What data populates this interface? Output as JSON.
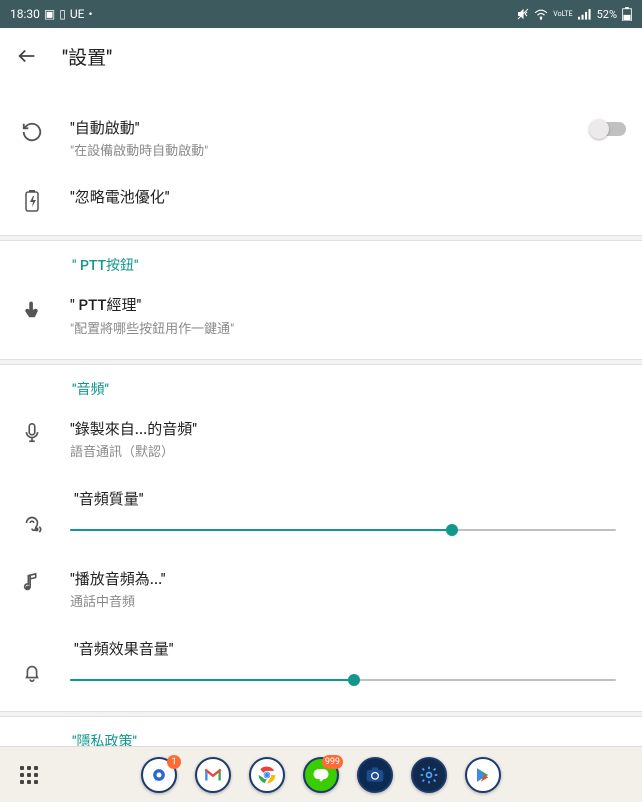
{
  "status": {
    "time": "18:30",
    "carrier": "UE",
    "battery_pct": "52%"
  },
  "header": {
    "title": "\"設置\""
  },
  "sections": {
    "autostart": {
      "title": "\"自動啟動\"",
      "subtitle": "\"在設備啟動時自動啟動\"",
      "switch": false
    },
    "battery": {
      "title": "\"忽略電池優化\""
    },
    "ptt_header": "\" PTT按鈕\"",
    "ptt_manager": {
      "title": "\" PTT經理\"",
      "subtitle": "\"配置將哪些按鈕用作一鍵通\""
    },
    "audio_header": "\"音頻\"",
    "record": {
      "title": "\"錄製來自...的音頻\"",
      "subtitle": "語音通訊（默認）"
    },
    "quality": {
      "title": "\"音頻質量\"",
      "value": 70
    },
    "play_as": {
      "title": "\"播放音頻為...\"",
      "subtitle": "通話中音頻"
    },
    "fx_volume": {
      "title": "\"音頻效果音量\"",
      "value": 52
    },
    "privacy_header": "\"隱私政策\""
  },
  "dock": {
    "badges": {
      "chat": "1",
      "line": "999"
    }
  }
}
